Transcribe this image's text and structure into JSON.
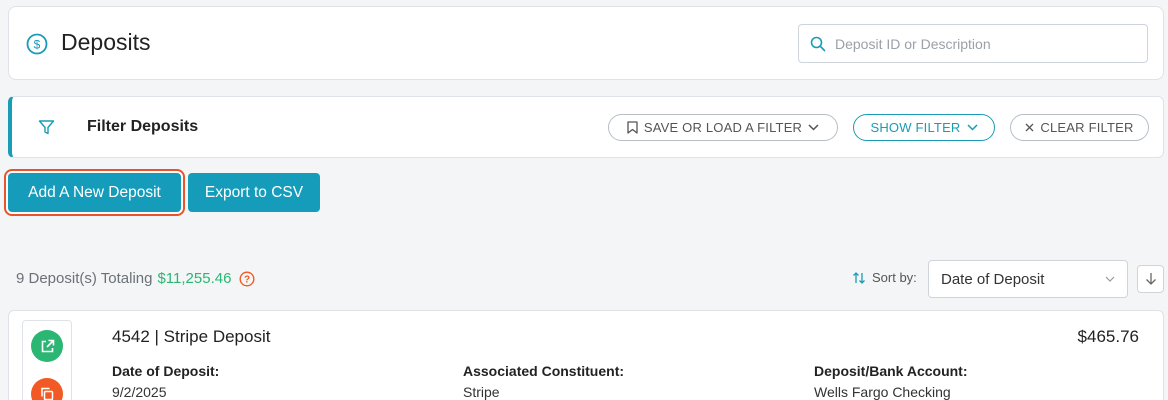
{
  "header": {
    "title": "Deposits",
    "icon": "dollar-circle-icon"
  },
  "search": {
    "placeholder": "Deposit ID or Description",
    "value": ""
  },
  "filter": {
    "title": "Filter Deposits",
    "save_label": "SAVE OR LOAD A FILTER",
    "show_label": "SHOW FILTER",
    "clear_label": "CLEAR FILTER"
  },
  "actions": {
    "add_label": "Add A New Deposit",
    "export_label": "Export to CSV"
  },
  "summary": {
    "count_text": "9 Deposit(s) Totaling",
    "total": "$11,255.46"
  },
  "sort": {
    "label": "Sort by:",
    "selected": "Date of Deposit"
  },
  "deposits": [
    {
      "title": "4542 | Stripe Deposit",
      "amount": "$465.76",
      "fields": [
        {
          "label": "Date of Deposit:",
          "value": "9/2/2025"
        },
        {
          "label": "Associated Constituent:",
          "value": "Stripe"
        },
        {
          "label": "Deposit/Bank Account:",
          "value": "Wells Fargo Checking"
        }
      ]
    }
  ],
  "colors": {
    "accent": "#159cba",
    "success": "#2bb673",
    "warning": "#f15a24",
    "highlight": "#e8542b"
  }
}
